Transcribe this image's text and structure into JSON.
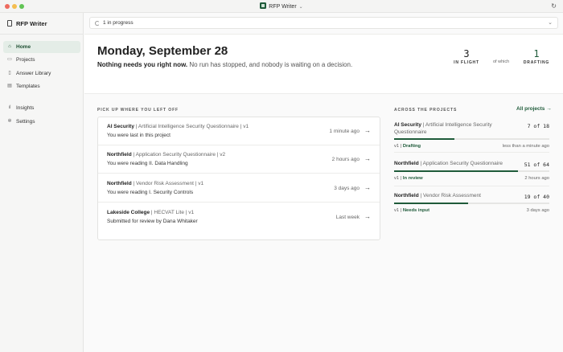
{
  "window": {
    "title": "RFP Writer",
    "refresh_icon": "refresh-icon"
  },
  "sidebar": {
    "brand": "RFP Writer",
    "items": [
      {
        "label": "Home",
        "icon": "home-icon",
        "active": true
      },
      {
        "label": "Projects",
        "icon": "folder-icon"
      },
      {
        "label": "Answer Library",
        "icon": "book-icon"
      },
      {
        "label": "Templates",
        "icon": "template-icon"
      },
      {
        "label": "Insights",
        "icon": "chart-icon"
      },
      {
        "label": "Settings",
        "icon": "gear-icon"
      }
    ]
  },
  "progress": {
    "label": "1 in progress"
  },
  "header": {
    "date": "Monday, September 28",
    "subtitle_bold": "Nothing needs you right now.",
    "subtitle_rest": " No run has stopped, and nobody is waiting on a decision.",
    "in_flight_value": "3",
    "in_flight_label": "IN FLIGHT",
    "of_which": "of which",
    "drafting_value": "1",
    "drafting_label": "DRAFTING"
  },
  "recent": {
    "section_label": "PICK UP WHERE YOU LEFT OFF",
    "items": [
      {
        "client": "AI Security",
        "detail": " | Artificial Intelligence Security Questionnaire | v1",
        "note": "You were last in this project",
        "time": "1 minute ago"
      },
      {
        "client": "Northfield",
        "detail": " | Application Security Questionnaire | v2",
        "note": "You were reading II. Data Handling",
        "time": "2 hours ago"
      },
      {
        "client": "Northfield",
        "detail": " | Vendor Risk Assessment | v1",
        "note": "You were reading I. Security Controls",
        "time": "3 days ago"
      },
      {
        "client": "Lakeside College",
        "detail": " | HECVAT Lite | v1",
        "note": "Submitted for review by Dana Whitaker",
        "time": "Last week"
      }
    ]
  },
  "across": {
    "section_label": "ACROSS THE PROJECTS",
    "all_link": "All projects →",
    "projects": [
      {
        "client": "AI Security",
        "detail": " | Artificial Intelligence Security Questionnaire",
        "count": "7 of 18",
        "progress": 0.39,
        "version": "v1 | ",
        "status": "Drafting",
        "time": "less than a minute ago"
      },
      {
        "client": "Northfield",
        "detail": " | Application Security Questionnaire",
        "count": "51 of 64",
        "progress": 0.8,
        "version": "v1 | ",
        "status": "In review",
        "time": "2 hours ago"
      },
      {
        "client": "Northfield",
        "detail": " | Vendor Risk Assessment",
        "count": "19 of 40",
        "progress": 0.475,
        "version": "v1 | ",
        "status": "Needs input",
        "time": "3 days ago"
      }
    ]
  },
  "colors": {
    "accent": "#1f5b3a",
    "active_nav_bg": "#e4ede7"
  }
}
